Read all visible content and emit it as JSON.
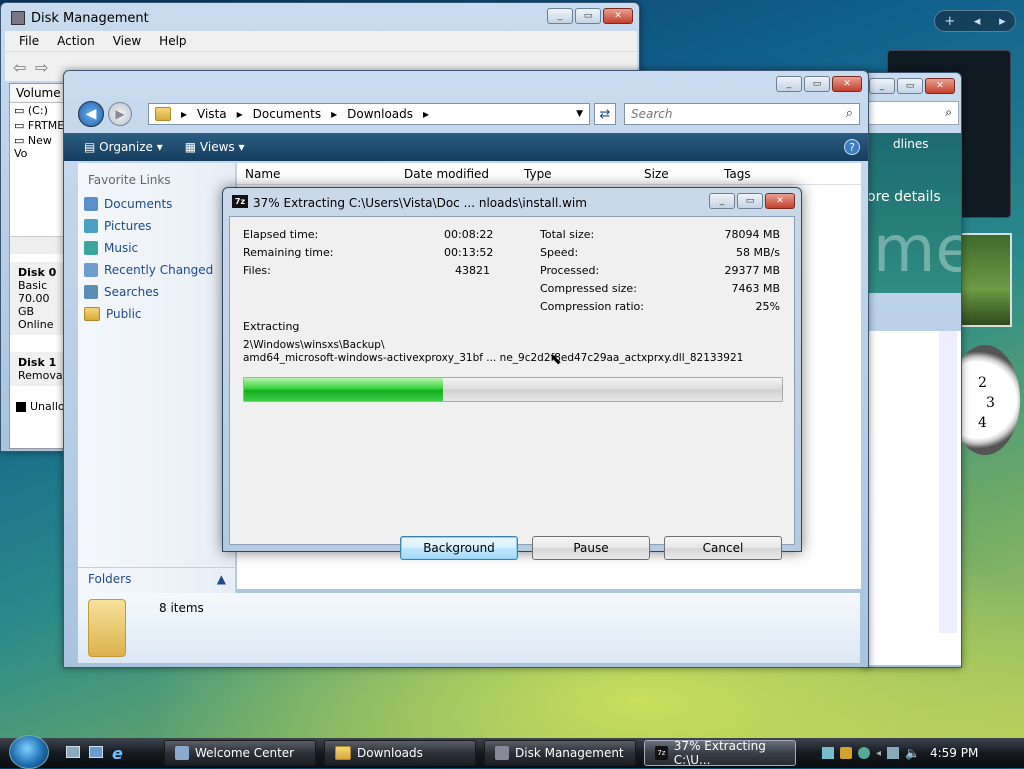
{
  "disk_mgmt": {
    "title": "Disk Management",
    "menu": [
      "File",
      "Action",
      "View",
      "Help"
    ],
    "volume_header": "Volume",
    "volumes": [
      "(C:)",
      "FRTME",
      "New Vo"
    ],
    "disk0": {
      "name": "Disk 0",
      "type": "Basic",
      "size": "70.00 GB",
      "status": "Online"
    },
    "disk1": {
      "name": "Disk 1",
      "type": "Removab"
    },
    "legend": "Unalloca"
  },
  "explorer": {
    "breadcrumb": [
      "Vista",
      "Documents",
      "Downloads"
    ],
    "search_placeholder": "Search",
    "toolbar": {
      "organize": "Organize",
      "views": "Views"
    },
    "favorite_links_title": "Favorite Links",
    "links": [
      "Documents",
      "Pictures",
      "Music",
      "Recently Changed",
      "Searches",
      "Public"
    ],
    "columns": [
      "Name",
      "Date modified",
      "Type",
      "Size",
      "Tags"
    ],
    "folders_label": "Folders",
    "item_count": "8 items"
  },
  "bg_window": {
    "right_text1": "dlines",
    "right_text2": "ore details",
    "right_big": "me"
  },
  "dialog": {
    "title": "37% Extracting C:\\Users\\Vista\\Doc ... nloads\\install.wim",
    "left": [
      {
        "label": "Elapsed time:",
        "value": "00:08:22"
      },
      {
        "label": "Remaining time:",
        "value": "00:13:52"
      },
      {
        "label": "Files:",
        "value": "43821"
      }
    ],
    "right": [
      {
        "label": "Total size:",
        "value": "78094 MB"
      },
      {
        "label": "Speed:",
        "value": "58 MB/s"
      },
      {
        "label": "Processed:",
        "value": "29377 MB"
      },
      {
        "label": "Compressed size:",
        "value": "7463 MB"
      },
      {
        "label": "Compression ratio:",
        "value": "25%"
      }
    ],
    "status_label": "Extracting",
    "path_line1": "2\\Windows\\winsxs\\Backup\\",
    "path_line2": "amd64_microsoft-windows-activexproxy_31bf ... ne_9c2d2f8ed47c29aa_actxprxy.dll_82133921",
    "progress": 0.37,
    "buttons": {
      "background": "Background",
      "pause": "Pause",
      "cancel": "Cancel"
    }
  },
  "taskbar": {
    "items": [
      "Welcome Center",
      "Downloads",
      "Disk Management",
      "37% Extracting C:\\U..."
    ],
    "clock": "4:59 PM"
  },
  "colors": {
    "accent": "#1e4a8c",
    "progress": "#19b82b",
    "toolbar": "#1c4a6b"
  }
}
